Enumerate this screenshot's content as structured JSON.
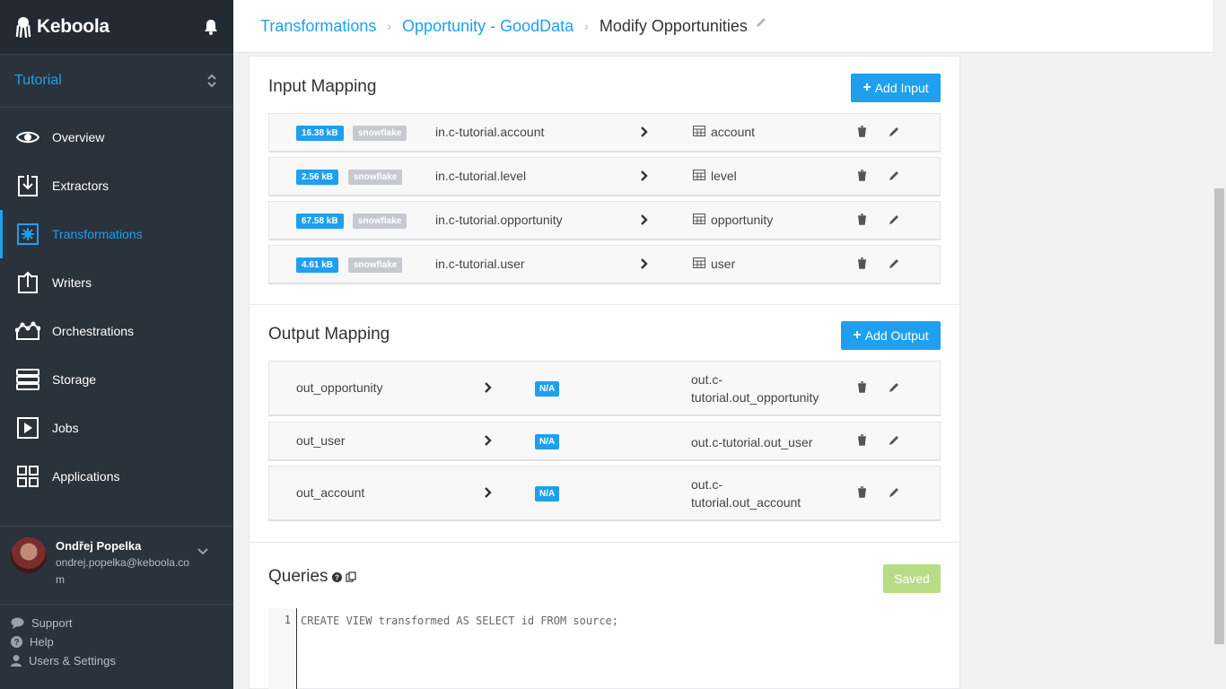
{
  "app": {
    "name": "Keboola"
  },
  "project": {
    "name": "Tutorial"
  },
  "nav": [
    {
      "label": "Overview",
      "icon": "eye-icon"
    },
    {
      "label": "Extractors",
      "icon": "extractor-icon"
    },
    {
      "label": "Transformations",
      "icon": "transformation-icon",
      "active": true
    },
    {
      "label": "Writers",
      "icon": "writer-icon"
    },
    {
      "label": "Orchestrations",
      "icon": "orchestration-icon"
    },
    {
      "label": "Storage",
      "icon": "storage-icon"
    },
    {
      "label": "Jobs",
      "icon": "jobs-icon"
    },
    {
      "label": "Applications",
      "icon": "applications-icon"
    }
  ],
  "user": {
    "name": "Ondřej Popelka",
    "email": "ondrej.popelka@keboola.com"
  },
  "bottom_links": {
    "support": "Support",
    "help": "Help",
    "settings": "Users & Settings"
  },
  "breadcrumb": {
    "level1": "Transformations",
    "level2": "Opportunity - GoodData",
    "current": "Modify Opportunities"
  },
  "input_mapping": {
    "title": "Input Mapping",
    "add_label": "Add Input",
    "rows": [
      {
        "size": "16.38 kB",
        "backend": "snowflake",
        "source": "in.c-tutorial.account",
        "dest": "account"
      },
      {
        "size": "2.56 kB",
        "backend": "snowflake",
        "source": "in.c-tutorial.level",
        "dest": "level"
      },
      {
        "size": "67.58 kB",
        "backend": "snowflake",
        "source": "in.c-tutorial.opportunity",
        "dest": "opportunity"
      },
      {
        "size": "4.61 kB",
        "backend": "snowflake",
        "source": "in.c-tutorial.user",
        "dest": "user"
      }
    ]
  },
  "output_mapping": {
    "title": "Output Mapping",
    "add_label": "Add Output",
    "rows": [
      {
        "source": "out_opportunity",
        "status": "N/A",
        "dest_line1": "out.c-",
        "dest_line2": "tutorial.out_opportunity"
      },
      {
        "source": "out_user",
        "status": "N/A",
        "dest_line1": "out.c-tutorial.out_user",
        "dest_line2": ""
      },
      {
        "source": "out_account",
        "status": "N/A",
        "dest_line1": "out.c-",
        "dest_line2": "tutorial.out_account"
      }
    ]
  },
  "queries": {
    "title": "Queries",
    "saved_label": "Saved",
    "lines": [
      {
        "num": "1",
        "text": "CREATE VIEW transformed AS SELECT id FROM source;"
      }
    ]
  },
  "colors": {
    "accent": "#1ea0ef",
    "sidebar": "#2a323c",
    "saved": "#b8dc86"
  }
}
